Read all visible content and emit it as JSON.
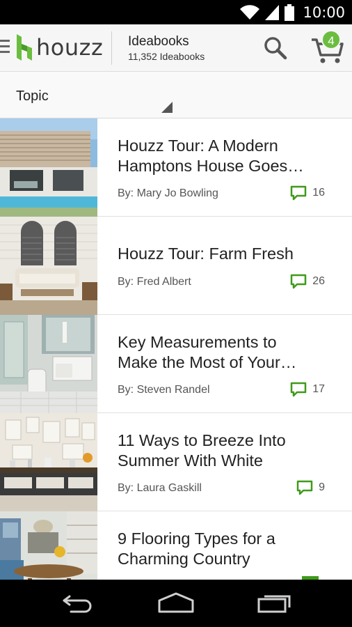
{
  "status_bar": {
    "time": "10:00"
  },
  "app_bar": {
    "logo_text": "houzz",
    "title": "Ideabooks",
    "subtitle": "11,352 Ideabooks",
    "cart_count": "4"
  },
  "filter": {
    "label": "Topic"
  },
  "articles": [
    {
      "title_line1": "Houzz Tour: A Modern",
      "title_line2": "Hamptons House Goes…",
      "author": "By: Mary Jo Bowling",
      "comments": "16"
    },
    {
      "title_line1": "Houzz Tour: Farm Fresh",
      "title_line2": "",
      "author": "By: Fred Albert",
      "comments": "26"
    },
    {
      "title_line1": "Key Measurements to",
      "title_line2": "Make the Most of Your…",
      "author": "By: Steven Randel",
      "comments": "17"
    },
    {
      "title_line1": "11 Ways to Breeze Into",
      "title_line2": "Summer With White",
      "author": "By: Laura Gaskill",
      "comments": "9"
    },
    {
      "title_line1": "9 Flooring Types for a",
      "title_line2": "Charming Country",
      "author": "",
      "comments": ""
    }
  ],
  "colors": {
    "accent_green": "#6bbd3f",
    "comment_green": "#3f9a1a"
  }
}
